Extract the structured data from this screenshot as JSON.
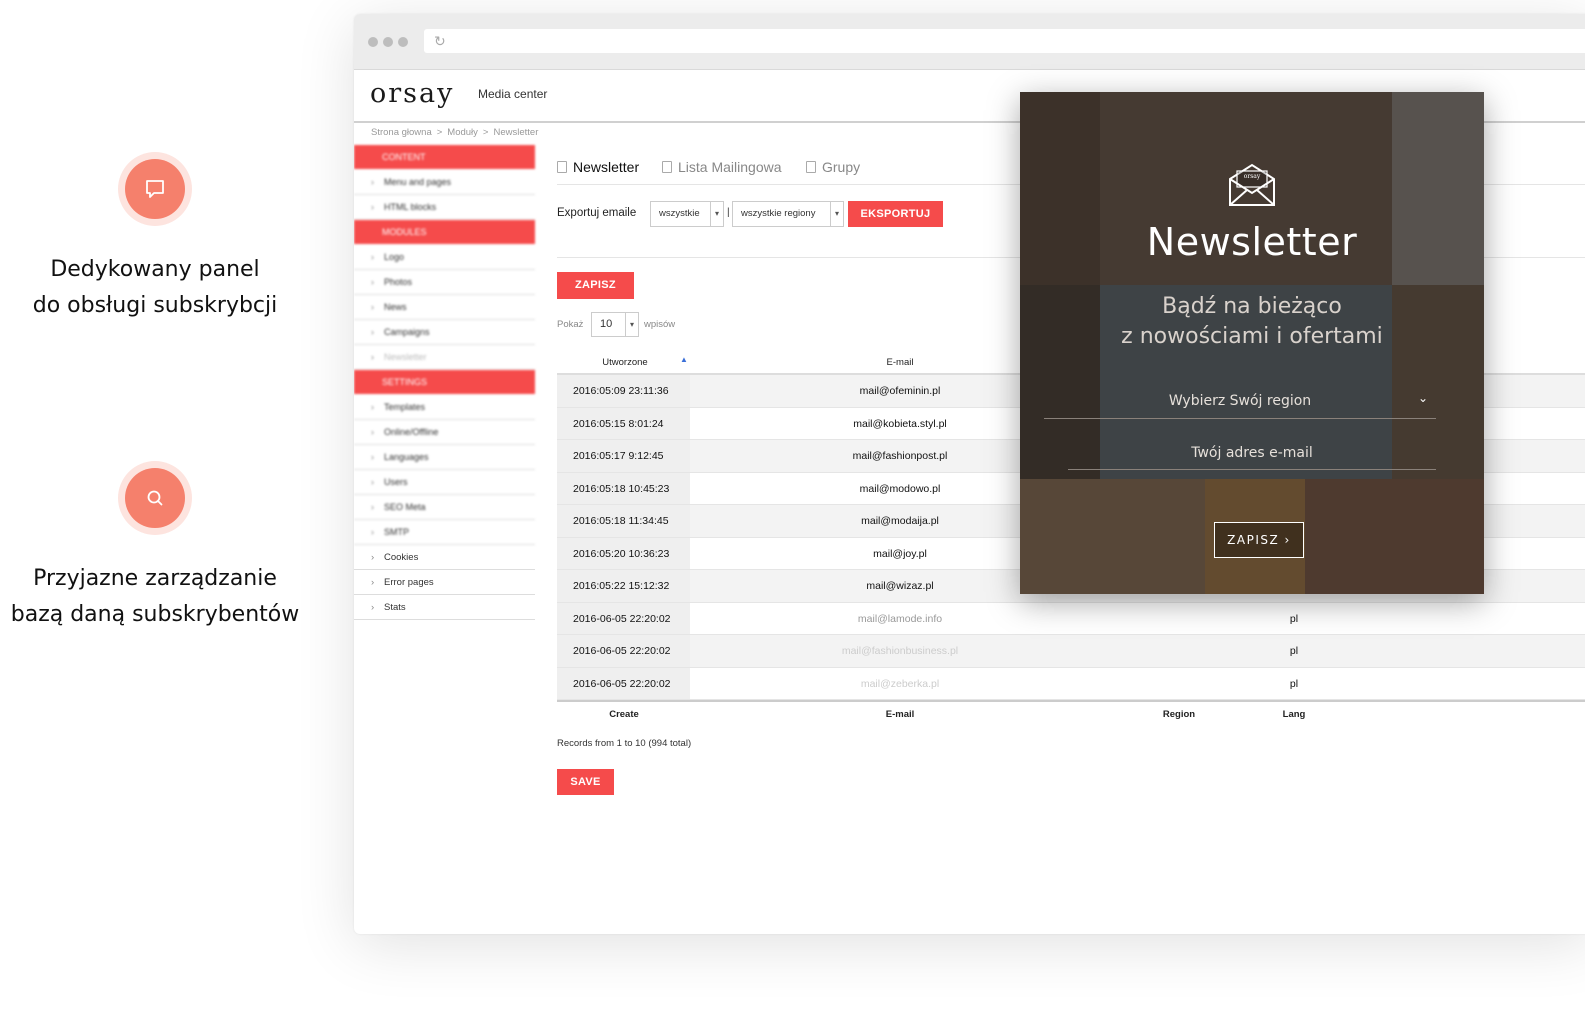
{
  "features": [
    {
      "icon": "chat-bubble-icon",
      "line1": "Dedykowany panel",
      "line2": "do obsługi subskrybcji"
    },
    {
      "icon": "search-icon",
      "line1": "Przyjazne zarządzanie",
      "line2": "bazą daną subskrybentów"
    }
  ],
  "app": {
    "logo": "orsay",
    "subtitle": "Media center"
  },
  "breadcrumb": [
    "Strona głowna",
    "Moduły",
    "Newsletter"
  ],
  "sidebar": {
    "sections": [
      "CONTENT",
      "MODULES",
      "SETTINGS"
    ],
    "content_items": [
      "Menu and pages",
      "HTML blocks"
    ],
    "module_items": [
      "Logo",
      "Photos",
      "News",
      "Campaigns",
      "Newsletter"
    ],
    "settings_items": [
      "Templates",
      "Online/Offline",
      "Languages",
      "Users",
      "SEO Meta",
      "SMTP",
      "Cookies",
      "Error pages",
      "Stats"
    ]
  },
  "tabs": [
    {
      "label": "Newsletter",
      "active": true
    },
    {
      "label": "Lista Mailingowa",
      "active": false
    },
    {
      "label": "Grupy",
      "active": false
    }
  ],
  "export": {
    "label": "Exportuj emaile",
    "filter1": "wszystkie",
    "separator": "|",
    "filter2": "wszystkie regiony",
    "button": "EKSPORTUJ"
  },
  "save_top": "ZAPISZ",
  "show": {
    "prefix": "Pokaż",
    "value": "10",
    "suffix": "wpisów"
  },
  "table": {
    "headers": {
      "created": "Utworzone",
      "email": "E-mail"
    },
    "rows": [
      {
        "date": "2016:05:09 23:11:36",
        "email": "mail@ofeminin.pl",
        "lang": ""
      },
      {
        "date": "2016:05:15 8:01:24",
        "email": "mail@kobieta.styl.pl",
        "lang": ""
      },
      {
        "date": "2016:05:17 9:12:45",
        "email": "mail@fashionpost.pl",
        "lang": ""
      },
      {
        "date": "2016:05:18 10:45:23",
        "email": "mail@modowo.pl",
        "lang": ""
      },
      {
        "date": "2016:05:18 11:34:45",
        "email": "mail@modaija.pl",
        "lang": ""
      },
      {
        "date": "2016:05:20 10:36:23",
        "email": "mail@joy.pl",
        "lang": ""
      },
      {
        "date": "2016:05:22 15:12:32",
        "email": "mail@wizaz.pl",
        "lang": ""
      },
      {
        "date": "2016-06-05 22:20:02",
        "email": "mail@lamode.info",
        "lang": "pl"
      },
      {
        "date": "2016-06-05 22:20:02",
        "email": "mail@fashionbusiness.pl",
        "lang": "pl"
      },
      {
        "date": "2016-06-05 22:20:02",
        "email": "mail@zeberka.pl",
        "lang": "pl"
      }
    ],
    "footer": {
      "create": "Create",
      "email": "E-mail",
      "region": "Region",
      "lang": "Lang"
    }
  },
  "records": "Records from 1 to 10 (994 total)",
  "save_bottom": "SAVE",
  "popup": {
    "envelope_text": "orsay",
    "title": "Newsletter",
    "subtitle_line1": "Bądź na bieżąco",
    "subtitle_line2": "z nowościami i ofertami",
    "region_placeholder": "Wybierz Swój region",
    "email_placeholder": "Twój adres e-mail",
    "button": "ZAPISZ"
  },
  "colors": {
    "accent": "#f54b4b",
    "feature_circle": "#f5806c",
    "feature_ring": "#fde4df"
  }
}
